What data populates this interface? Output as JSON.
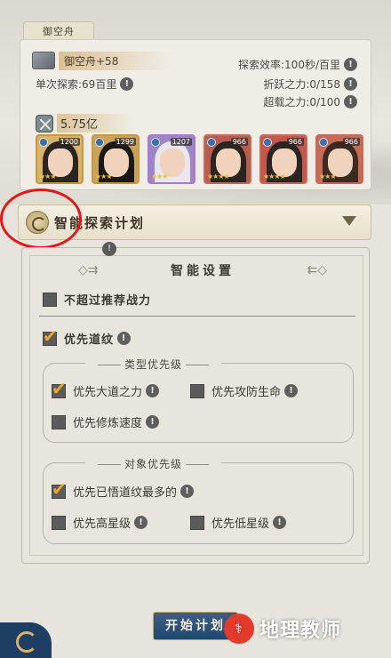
{
  "header": {
    "tab_title": "御空舟"
  },
  "ship": {
    "name_level": "御空舟+58",
    "single_explore": "单次探索:69百里",
    "efficiency": "探索效率:100秒/百里",
    "break_power": "折跃之力:0/158",
    "carry_power": "超载之力:0/100",
    "total_power": "5.75亿"
  },
  "heroes": [
    {
      "level": "1200",
      "stars": "★★★"
    },
    {
      "level": "1299",
      "stars": "★★★"
    },
    {
      "level": "1207",
      "stars": "★★★"
    },
    {
      "level": "966",
      "stars": "★★★★"
    },
    {
      "level": "966",
      "stars": "★★★★"
    },
    {
      "level": "966",
      "stars": "★★★"
    }
  ],
  "plan": {
    "title": "智能探索计划"
  },
  "settings": {
    "pin": "!",
    "title": "智能设置",
    "no_exceed": "不超过推荐战力",
    "prefer_daowen": "优先道纹",
    "type_group": {
      "title": "类型优先级",
      "options": [
        "优先大道之力",
        "优先攻防生命",
        "优先修炼速度"
      ]
    },
    "target_group": {
      "title": "对象优先级",
      "options": [
        "优先已悟道纹最多的",
        "优先高星级",
        "优先低星级"
      ]
    }
  },
  "bottom": {
    "start_button": "开始计划"
  },
  "watermark": {
    "text": "地理教师"
  },
  "colors": {
    "annotation_circle": "#e2171b",
    "check_mark": "#e7a833",
    "button_bg": "#23466b"
  }
}
